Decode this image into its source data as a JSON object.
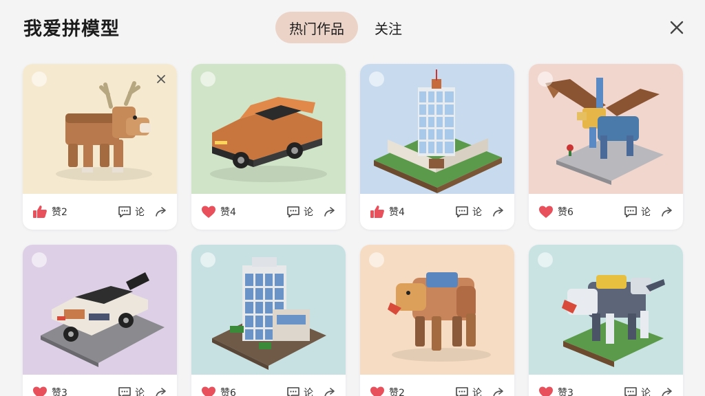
{
  "app": {
    "title": "我爱拼模型"
  },
  "tabs": [
    {
      "label": "热门作品",
      "active": true
    },
    {
      "label": "关注",
      "active": false
    }
  ],
  "colors": {
    "tab_active_bg": "#ecd3c8",
    "like_red": "#e8505b"
  },
  "cards": [
    {
      "model": "deer",
      "bg": "#f5e9cf",
      "like_icon": "thumbs-up-icon",
      "like_label": "赞2",
      "comment_label": "论",
      "has_close": true
    },
    {
      "model": "car-orange",
      "bg": "#d0e4c8",
      "like_icon": "heart-icon",
      "like_label": "赞4",
      "comment_label": "论",
      "has_close": false
    },
    {
      "model": "building-blue",
      "bg": "#c8dbee",
      "like_icon": "thumbs-up-icon",
      "like_label": "赞4",
      "comment_label": "论",
      "has_close": false
    },
    {
      "model": "griffin",
      "bg": "#f1d6cd",
      "like_icon": "heart-icon",
      "like_label": "赞6",
      "comment_label": "论",
      "has_close": false
    },
    {
      "model": "car-white",
      "bg": "#ddd0e6",
      "like_icon": "heart-icon",
      "like_label": "赞3",
      "comment_label": "论",
      "has_close": false
    },
    {
      "model": "building-tower",
      "bg": "#c7e1e2",
      "like_icon": "heart-icon",
      "like_label": "赞6",
      "comment_label": "论",
      "has_close": false
    },
    {
      "model": "bear",
      "bg": "#f5dcc2",
      "like_icon": "heart-icon",
      "like_label": "赞2",
      "comment_label": "论",
      "has_close": false
    },
    {
      "model": "robot-dog",
      "bg": "#c9e3e3",
      "like_icon": "heart-icon",
      "like_label": "赞3",
      "comment_label": "论",
      "has_close": false
    }
  ]
}
